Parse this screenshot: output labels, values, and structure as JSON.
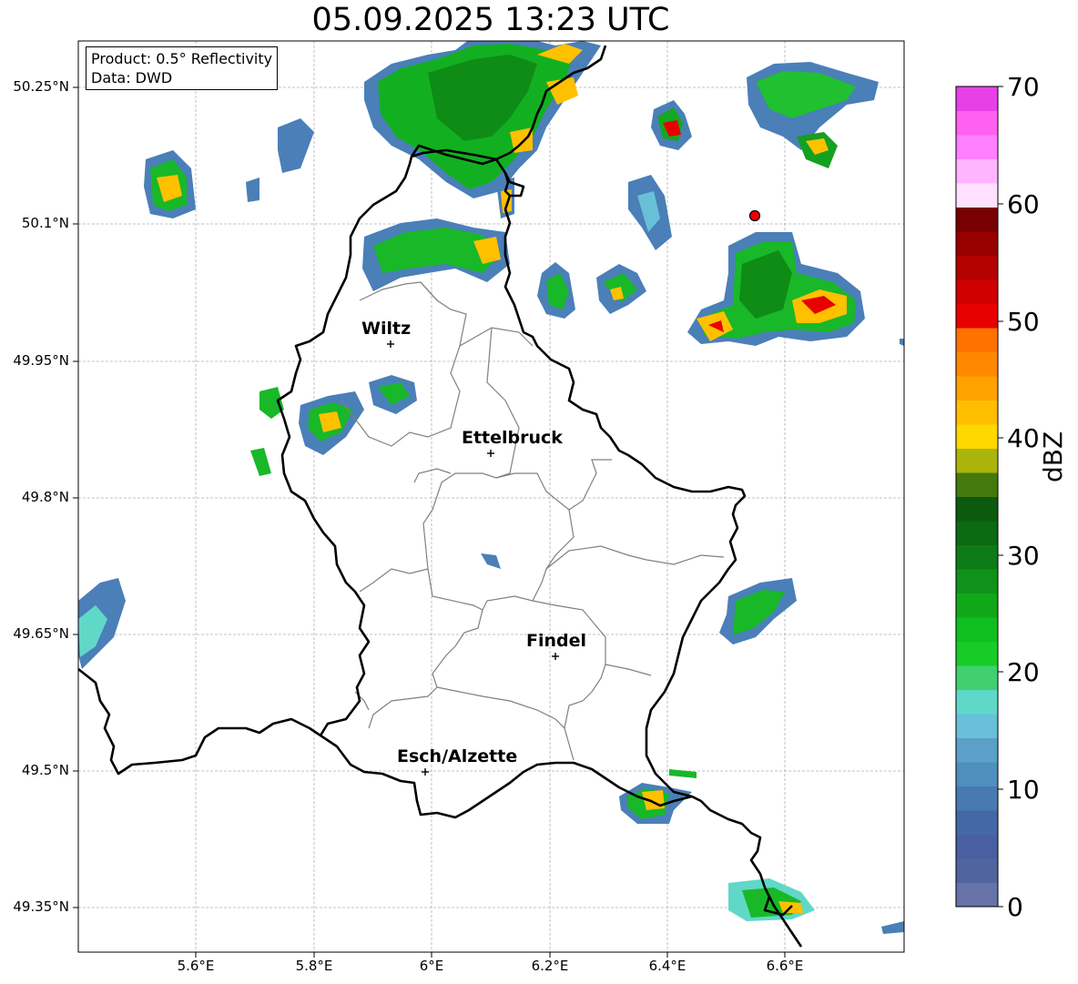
{
  "title": "05.09.2025 13:23 UTC",
  "info": {
    "product": "Product: 0.5° Reflectivity",
    "source": "Data: DWD"
  },
  "lat_labels": [
    "50.25°N",
    "50.1°N",
    "49.95°N",
    "49.8°N",
    "49.65°N",
    "49.5°N",
    "49.35°N"
  ],
  "lon_labels": [
    "5.6°E",
    "5.8°E",
    "6°E",
    "6.2°E",
    "6.4°E",
    "6.6°E"
  ],
  "cities": [
    {
      "name": "Wiltz"
    },
    {
      "name": "Ettelbruck"
    },
    {
      "name": "Findel"
    },
    {
      "name": "Esch/Alzette"
    }
  ],
  "colorbar": {
    "label": "dBZ",
    "ticks": [
      "70",
      "60",
      "50",
      "40",
      "30",
      "20",
      "10",
      "0"
    ],
    "range": [
      0,
      70
    ],
    "step": 2.5,
    "colors": [
      "#6672a8",
      "#52649e",
      "#4a5fa2",
      "#4468a6",
      "#4879b0",
      "#4e8fbe",
      "#5aa0c8",
      "#68c0d8",
      "#60d8c8",
      "#40d070",
      "#18cc28",
      "#10be20",
      "#10a818",
      "#10921a",
      "#0e7c16",
      "#0c6a12",
      "#0c5a0e",
      "#447a0c",
      "#aab40a",
      "#ffd800",
      "#ffbe00",
      "#ffa200",
      "#ff8800",
      "#ff7200",
      "#e80000",
      "#d00000",
      "#b40000",
      "#980000",
      "#780000",
      "#ffe0ff",
      "#ffb4ff",
      "#ff80ff",
      "#ff60f0",
      "#e840e8"
    ]
  },
  "marker_color": "#e80000"
}
